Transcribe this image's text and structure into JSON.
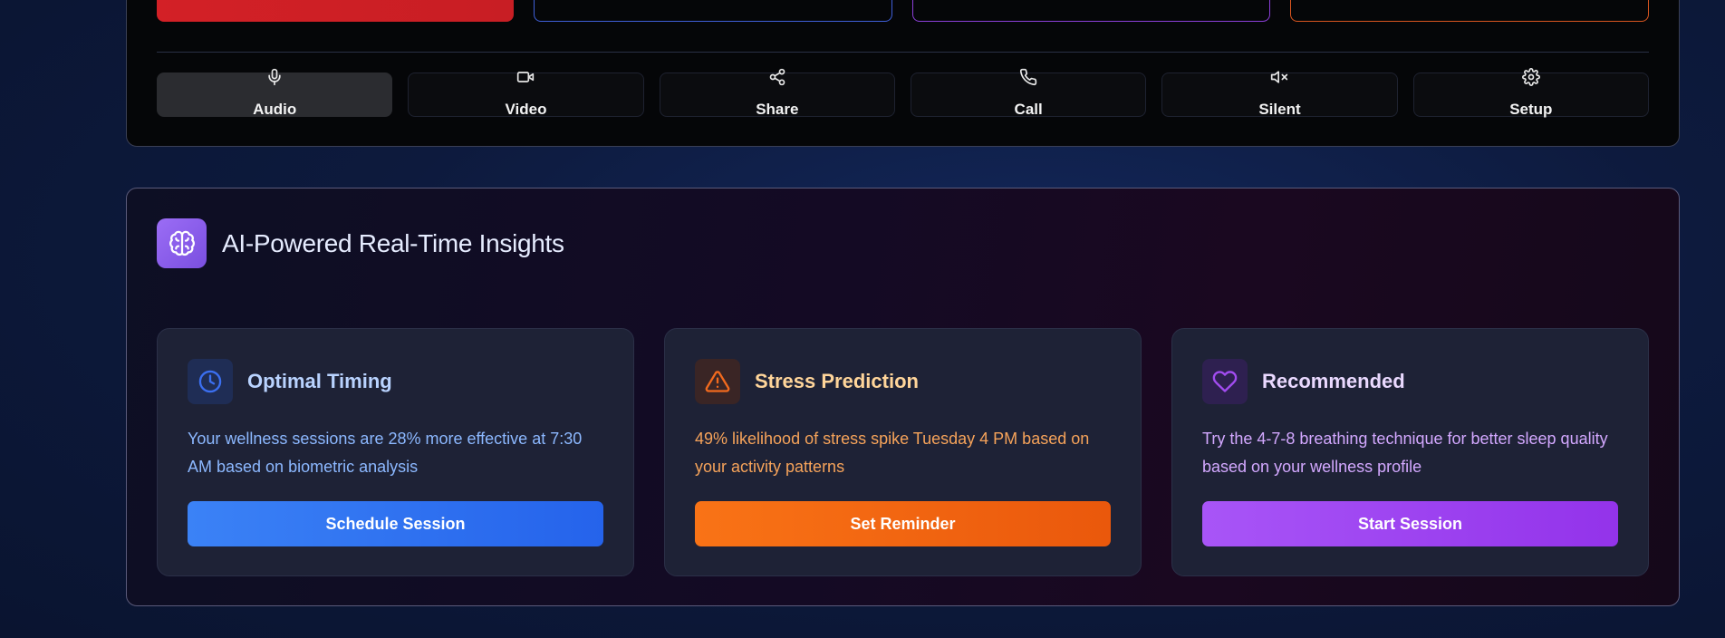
{
  "controls": {
    "items": [
      {
        "label": "Audio",
        "icon": "microphone-icon"
      },
      {
        "label": "Video",
        "icon": "video-icon"
      },
      {
        "label": "Share",
        "icon": "share-icon"
      },
      {
        "label": "Call",
        "icon": "phone-icon"
      },
      {
        "label": "Silent",
        "icon": "mute-icon"
      },
      {
        "label": "Setup",
        "icon": "gear-icon"
      }
    ],
    "active": "Audio"
  },
  "insights": {
    "title": "AI-Powered Real-Time Insights",
    "icon": "brain-icon",
    "cards": [
      {
        "title": "Optimal Timing",
        "icon": "clock-icon",
        "text": "Your wellness sessions are 28% more effective at 7:30 AM based on biometric analysis",
        "button": "Schedule Session",
        "accent": "#3b82f6"
      },
      {
        "title": "Stress Prediction",
        "icon": "warning-icon",
        "text": "49% likelihood of stress spike Tuesday 4 PM based on your activity patterns",
        "button": "Set Reminder",
        "accent": "#f97316"
      },
      {
        "title": "Recommended",
        "icon": "heart-icon",
        "text": "Try the 4-7-8 breathing technique for better sleep quality based on your wellness profile",
        "button": "Start Session",
        "accent": "#a855f7"
      }
    ]
  },
  "colors": {
    "mode_red": "#d32026",
    "mode_blue": "#3f5fd8",
    "mode_purple": "#8b3fd8",
    "mode_orange": "#d8551f"
  }
}
